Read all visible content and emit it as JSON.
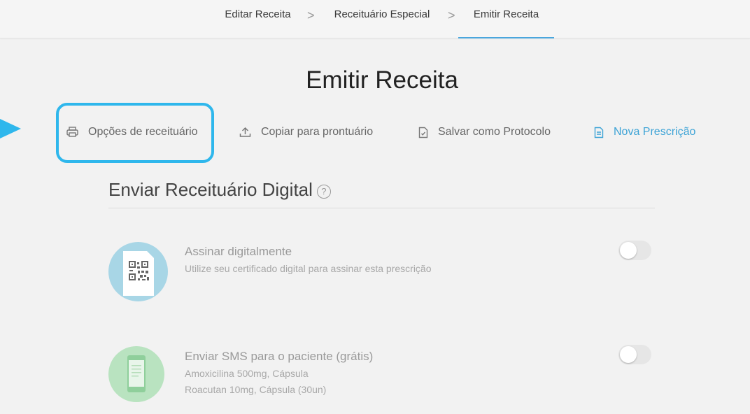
{
  "stepper": {
    "steps": [
      {
        "label": "Editar Receita"
      },
      {
        "label": "Receituário Especial"
      },
      {
        "label": "Emitir Receita"
      }
    ],
    "separator": ">",
    "active_index": 2
  },
  "page": {
    "title": "Emitir Receita"
  },
  "actions": {
    "print_options": {
      "label": "Opções de receituário",
      "icon": "printer-icon"
    },
    "copy_record": {
      "label": "Copiar para prontuário",
      "icon": "upload-icon"
    },
    "save_protocol": {
      "label": "Salvar como Protocolo",
      "icon": "document-check-icon"
    },
    "new_prescription": {
      "label": "Nova Prescrição",
      "icon": "document-icon"
    }
  },
  "digital": {
    "title": "Enviar Receituário Digital",
    "help": "?",
    "options": [
      {
        "title": "Assinar digitalmente",
        "lines": [
          "Utilize seu certificado digital para assinar esta prescrição"
        ],
        "icon": "qr-document-icon",
        "enabled": false
      },
      {
        "title": "Enviar SMS para o paciente (grátis)",
        "lines": [
          "Amoxicilina 500mg, Cápsula",
          "Roacutan 10mg, Cápsula (30un)"
        ],
        "icon": "phone-icon",
        "enabled": false
      }
    ]
  },
  "colors": {
    "accent": "#3ca3d6",
    "highlight": "#2fb7ec",
    "active_step_underline": "#4aa6dd"
  }
}
